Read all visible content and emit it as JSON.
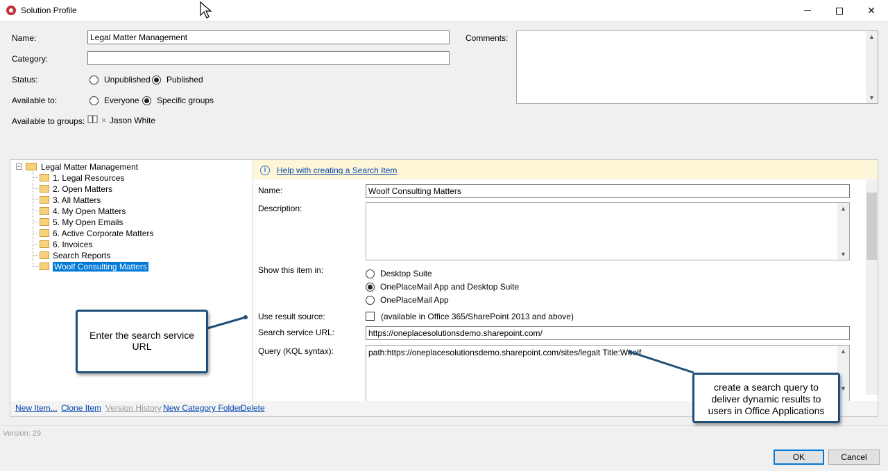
{
  "window": {
    "title": "Solution Profile"
  },
  "profile": {
    "name_label": "Name:",
    "name_value": "Legal Matter Management",
    "category_label": "Category:",
    "category_value": "",
    "status_label": "Status:",
    "status_options": [
      "Unpublished",
      "Published"
    ],
    "status_selected": "Published",
    "available_label": "Available to:",
    "available_options": [
      "Everyone",
      "Specific groups"
    ],
    "available_selected": "Specific groups",
    "groups_label": "Available to groups:",
    "groups": [
      "Jason White"
    ],
    "comments_label": "Comments:",
    "comments_value": ""
  },
  "tree": {
    "root": "Legal Matter Management",
    "items": [
      "1. Legal Resources",
      "2. Open Matters",
      "3. All Matters",
      "4. My Open Matters",
      "5. My Open Emails",
      "6. Active Corporate Matters",
      "6. Invoices",
      "Search Reports",
      "Woolf Consulting Matters"
    ],
    "selected": "Woolf Consulting Matters"
  },
  "help": {
    "link": "Help with creating a Search Item"
  },
  "item": {
    "name_label": "Name:",
    "name_value": "Woolf Consulting Matters",
    "description_label": "Description:",
    "description_value": "",
    "show_label": "Show this item in:",
    "show_options": [
      "Desktop Suite",
      "OnePlaceMail App and Desktop Suite",
      "OnePlaceMail App"
    ],
    "show_selected": "OnePlaceMail App and Desktop Suite",
    "result_source_label": "Use result source:",
    "result_source_note": "(available in Office 365/SharePoint 2013 and above)",
    "result_source_checked": false,
    "url_label": "Search service URL:",
    "url_value": "https://oneplacesolutionsdemo.sharepoint.com/",
    "query_label": "Query (KQL syntax):",
    "query_value": "path:https://oneplacesolutionsdemo.sharepoint.com/sites/legalt Title:Woolf"
  },
  "actions": {
    "new_item": "New Item...",
    "clone_item": "Clone Item",
    "version_history": "Version History",
    "new_category_folder": "New Category Folder",
    "delete": "Delete"
  },
  "footer": {
    "version": "Version: 29",
    "ok": "OK",
    "cancel": "Cancel"
  },
  "callouts": {
    "url_hint": "Enter the search service URL",
    "query_hint": "create a search query to deliver dynamic results to users in Office Applications"
  },
  "colors": {
    "accent": "#0078d7",
    "callout_border": "#1f4e79",
    "help_bg": "#fdf7d8"
  }
}
